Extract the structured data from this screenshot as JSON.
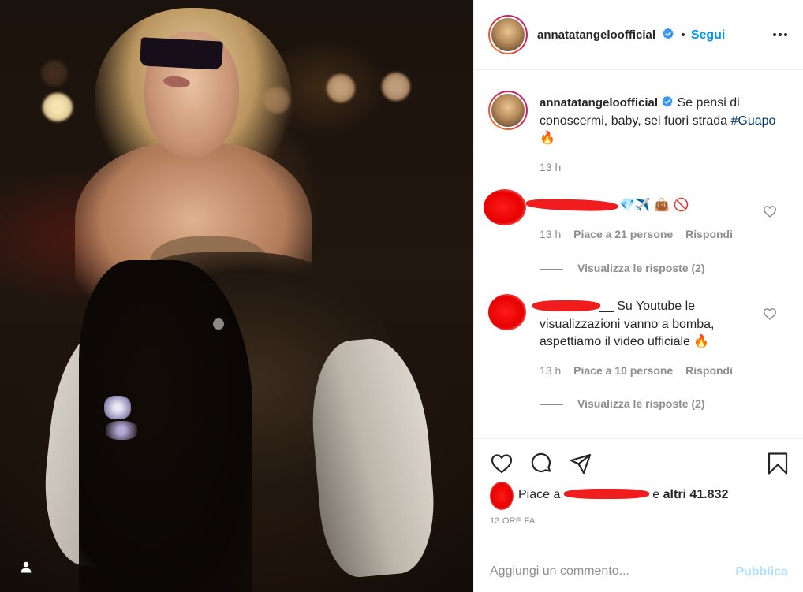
{
  "post": {
    "username": "annatatangeloofficial",
    "follow_label": "Segui",
    "separator": "•"
  },
  "caption": {
    "username": "annatatangeloofficial",
    "text_before_tag": "Se pensi di conoscermi, baby, sei fuori strada",
    "hashtag": "#Guapo",
    "emoji": "🔥",
    "time": "13 h"
  },
  "comments": [
    {
      "text": "💎✈️ 👜 🚫",
      "time": "13 h",
      "likes": "Piace a 21 persone",
      "reply": "Rispondi",
      "view_replies": "Visualizza le risposte (2)"
    },
    {
      "username_fragment": "__",
      "text": "Su Youtube le visualizzazioni vanno a bomba, aspettiamo il video ufficiale 🔥",
      "time": "13 h",
      "likes": "Piace a 10 persone",
      "reply": "Rispondi",
      "view_replies": "Visualizza le risposte (2)"
    }
  ],
  "likes": {
    "prefix": "Piace a",
    "conjunction": "e",
    "others": "altri 41.832"
  },
  "post_time": "13 ORE FA",
  "add_comment": {
    "placeholder": "Aggiungi un commento...",
    "publish_label": "Pubblica"
  },
  "colors": {
    "accent": "#0095f6",
    "publish_disabled": "#b2dffc",
    "muted": "#8e8e8e",
    "redaction": "#ef1d1d"
  },
  "icons": [
    "verified-icon",
    "more-icon",
    "heart-icon",
    "comment-icon",
    "share-icon",
    "bookmark-icon",
    "tag-user-icon"
  ]
}
